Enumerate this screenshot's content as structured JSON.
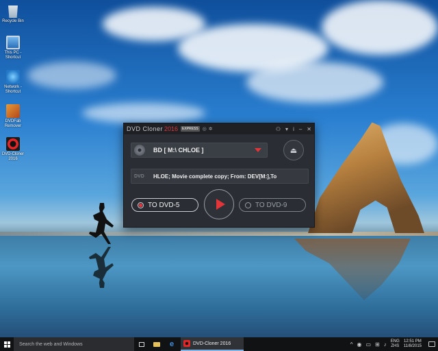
{
  "desktop": {
    "icons": [
      {
        "label": "Recycle Bin",
        "icon": "recycle-bin-icon"
      },
      {
        "label": "This PC - Shortcut",
        "icon": "computer-icon"
      },
      {
        "label": "Network - Shortcut",
        "icon": "network-icon"
      },
      {
        "label": "DVDFab Remover",
        "icon": "dvdfab-icon"
      },
      {
        "label": "DVD-Cloner 2016",
        "icon": "dvd-cloner-icon"
      }
    ]
  },
  "app": {
    "title": "DVD Cloner",
    "title_year": "2016",
    "badge": "EXPRESS",
    "title_icons": [
      "◎",
      "✲"
    ],
    "controls": {
      "network": "⚇",
      "settings": "▾",
      "info": "i",
      "minimize": "–",
      "close": "✕"
    },
    "source": {
      "label": "BD [ M:\\ CHLOE ]",
      "caret": "dropdown-caret"
    },
    "eject_glyph": "⏏",
    "mode": {
      "logo": "DVD",
      "text": "HLOE;  Movie complete copy;  From: DEV[M:],To"
    },
    "targets": [
      {
        "label": "TO DVD-5",
        "selected": true
      },
      {
        "label": "TO DVD-9",
        "selected": false
      }
    ],
    "start_button": "play-icon"
  },
  "taskbar": {
    "search_placeholder": "Search the web and Windows",
    "running_app": "DVD-Cloner 2016",
    "tray": {
      "glyphs": [
        "^",
        "◉",
        "▭",
        "⊞",
        "♪"
      ],
      "lang_1": "ENG",
      "lang_2": "ZHS",
      "time": "12:51 PM",
      "date": "11/8/2015"
    }
  },
  "colors": {
    "accent_red": "#e2353a",
    "window_bg": "#2a2d33",
    "taskbar_bg": "#101214"
  }
}
